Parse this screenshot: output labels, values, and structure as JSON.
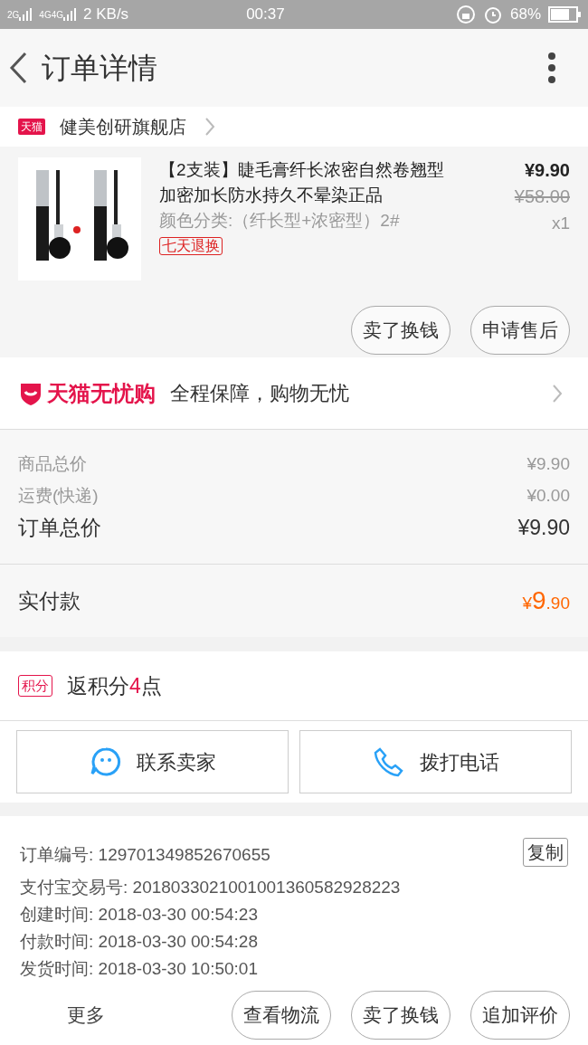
{
  "status_bar": {
    "network": "2G",
    "network_2": "4G",
    "network_3": "4G",
    "speed": "2 KB/s",
    "time": "00:37",
    "battery": "68%"
  },
  "header": {
    "title": "订单详情"
  },
  "store": {
    "badge": "天猫",
    "name": "健美创研旗舰店"
  },
  "product": {
    "title": "【2支装】睫毛膏纤长浓密自然卷翘型加密加长防水持久不晕染正品",
    "variant": "颜色分类:（纤长型+浓密型）2#",
    "tag": "七天退换",
    "price": "¥9.90",
    "original_price": "¥58.00",
    "quantity": "x1",
    "buttons": [
      "卖了换钱",
      "申请售后"
    ]
  },
  "guarantee": {
    "brand": "天猫无忧购",
    "text": "全程保障，购物无忧"
  },
  "costs": [
    {
      "label": "商品总价",
      "value": "¥9.90",
      "kind": "minor"
    },
    {
      "label": "运费(快递)",
      "value": "¥0.00",
      "kind": "minor"
    },
    {
      "label": "订单总价",
      "value": "¥9.90",
      "kind": "major"
    }
  ],
  "paid": {
    "label": "实付款",
    "currency": "¥",
    "integer": "9",
    "decimal": ".90"
  },
  "points": {
    "badge": "积分",
    "prefix": "返积分",
    "amount": "4",
    "suffix": "点"
  },
  "contact": [
    {
      "label": "联系卖家",
      "kind": "chat"
    },
    {
      "label": "拨打电话",
      "kind": "phone"
    }
  ],
  "order_info": [
    {
      "label": "订单编号:",
      "value": "129701349852670655"
    },
    {
      "label": "支付宝交易号:",
      "value": "2018033021001001360582928223"
    },
    {
      "label": "创建时间:",
      "value": "2018-03-30 00:54:23"
    },
    {
      "label": "付款时间:",
      "value": "2018-03-30 00:54:28"
    },
    {
      "label": "发货时间:",
      "value": "2018-03-30 10:50:01"
    }
  ],
  "copy_button": "复制",
  "bottom_bar": {
    "more": "更多",
    "buttons": [
      "查看物流",
      "卖了换钱",
      "追加评价"
    ]
  }
}
